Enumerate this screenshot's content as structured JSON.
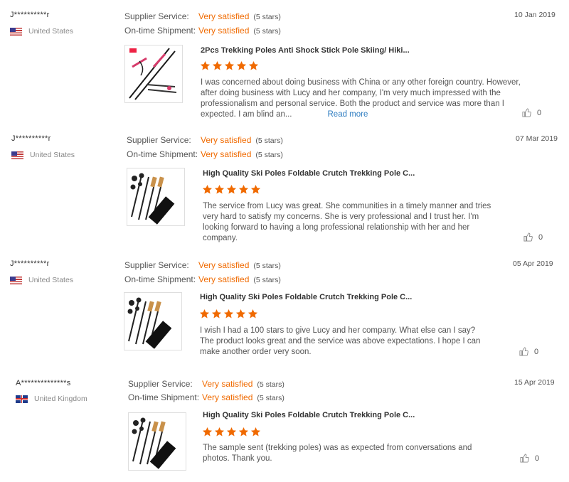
{
  "reviews": [
    {
      "buyer": "J**********r",
      "country": "United States",
      "flag": "us",
      "date": "10 Jan 2019",
      "supplier_label": "Supplier Service:",
      "supplier_value": "Very satisfied",
      "supplier_stars": "(5 stars)",
      "shipment_label": "On-time Shipment:",
      "shipment_value": "Very satisfied",
      "shipment_stars": "(5 stars)",
      "product_title": "2Pcs Trekking Poles Anti Shock Stick Pole Skiing/ Hiki...",
      "rating": 5,
      "text": "I was concerned about doing business with China or any other foreign country. However, after doing business with Lucy and her company, I'm very much impressed with the professionalism and personal service.  Both the product and service was more than I expected.  I am blind an...",
      "read_more": "Read more",
      "likes": "0"
    },
    {
      "buyer": "J**********r",
      "country": "United States",
      "flag": "us",
      "date": "07 Mar 2019",
      "supplier_label": "Supplier Service:",
      "supplier_value": "Very satisfied",
      "supplier_stars": "(5 stars)",
      "shipment_label": "On-time Shipment:",
      "shipment_value": "Very satisfied",
      "shipment_stars": "(5 stars)",
      "product_title": "High Quality Ski Poles Foldable Crutch Trekking Pole C...",
      "rating": 5,
      "text": "The service from Lucy was great.  She communities in a timely manner and tries very hard to satisfy my concerns.  She is very professional and I trust her.  I'm looking forward to having a long professional relationship with her and her company.",
      "likes": "0"
    },
    {
      "buyer": "J**********r",
      "country": "United States",
      "flag": "us",
      "date": "05 Apr 2019",
      "supplier_label": "Supplier Service:",
      "supplier_value": "Very satisfied",
      "supplier_stars": "(5 stars)",
      "shipment_label": "On-time Shipment:",
      "shipment_value": "Very satisfied",
      "shipment_stars": "(5 stars)",
      "product_title": "High Quality Ski Poles Foldable Crutch Trekking Pole C...",
      "rating": 5,
      "text": "I wish I had a 100 stars to give Lucy and her company.  What else can I say?  The product looks great and the service was above expectations. I hope I can make another order very soon.",
      "likes": "0"
    },
    {
      "buyer": "A**************s",
      "country": "United Kingdom",
      "flag": "uk",
      "date": "15 Apr 2019",
      "supplier_label": "Supplier Service:",
      "supplier_value": "Very satisfied",
      "supplier_stars": "(5 stars)",
      "shipment_label": "On-time Shipment:",
      "shipment_value": "Very satisfied",
      "shipment_stars": "(5 stars)",
      "product_title": "High Quality Ski Poles Foldable Crutch Trekking Pole C...",
      "rating": 5,
      "text": "The sample sent (trekking poles) was as expected from conversations and photos. Thank you.",
      "likes": "0"
    }
  ],
  "colors": {
    "accent": "#f06a00",
    "link": "#2f7dc1",
    "text": "#555555"
  }
}
